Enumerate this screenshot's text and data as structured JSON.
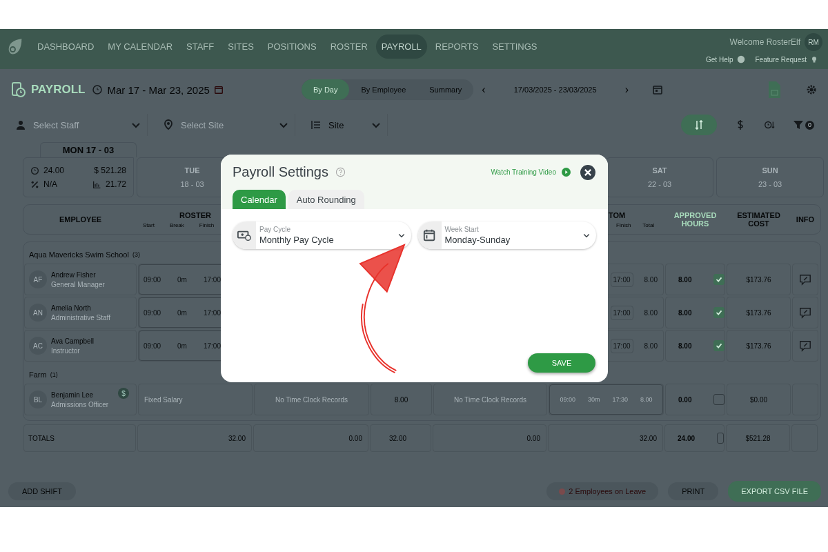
{
  "nav": {
    "items": [
      {
        "label": "DASHBOARD",
        "selected": false
      },
      {
        "label": "MY CALENDAR",
        "selected": false
      },
      {
        "label": "STAFF",
        "selected": false
      },
      {
        "label": "SITES",
        "selected": false
      },
      {
        "label": "POSITIONS",
        "selected": false
      },
      {
        "label": "ROSTER",
        "selected": false
      },
      {
        "label": "PAYROLL",
        "selected": true
      },
      {
        "label": "REPORTS",
        "selected": false
      },
      {
        "label": "SETTINGS",
        "selected": false
      }
    ],
    "welcome": "Welcome RosterElf",
    "avatar": "RM",
    "help": "Get Help",
    "feature": "Feature Request"
  },
  "header": {
    "title": "PAYROLL",
    "range": "Mar 17 - Mar 23, 2025",
    "views": [
      {
        "label": "By Day",
        "selected": true
      },
      {
        "label": "By Employee",
        "selected": false
      },
      {
        "label": "Summary",
        "selected": false
      }
    ],
    "prev": "‹",
    "date_range": "17/03/2025 - 23/03/2025",
    "next": "›"
  },
  "filters": {
    "staff": {
      "placeholder": "Select Staff"
    },
    "site": {
      "placeholder": "Select Site"
    },
    "group_by": {
      "value": "Site"
    },
    "filter_count": "0"
  },
  "days": [
    {
      "day": "MON",
      "date": "17 - 03",
      "selected": true,
      "hours": "24.00",
      "cost": "$ 521.28",
      "percent": "N/A",
      "average": "21.72"
    },
    {
      "day": "TUE",
      "date": "18 - 03",
      "selected": false
    },
    {
      "day": "SAT",
      "date": "22 - 03",
      "selected": false
    },
    {
      "day": "SUN",
      "date": "23 - 03",
      "selected": false
    }
  ],
  "table": {
    "columns": [
      {
        "title": "EMPLOYEE"
      },
      {
        "title": "ROSTER",
        "sub": [
          "Start",
          "Break",
          "Finish"
        ]
      },
      {
        "title": "TOM",
        "sub": [
          "Finish",
          "Total"
        ]
      },
      {
        "title": "APPROVED HOURS",
        "kind": "accent"
      },
      {
        "title": "ESTIMATED COST"
      },
      {
        "title": "INFO"
      }
    ],
    "groups": [
      {
        "name": "Aqua Mavericks Swim School",
        "count": "(3)",
        "rows": [
          {
            "kind": "shift",
            "initials": "AF",
            "name": "Andrew Fisher",
            "role": "General Manager",
            "roster": [
              "09:00",
              "0m",
              "17:00"
            ],
            "custom_finish": "17:00",
            "custom_total": "8.00",
            "approved": "8.00",
            "checked": true,
            "cost": "$173.76",
            "note": true
          },
          {
            "kind": "shift",
            "initials": "AN",
            "name": "Amelia North",
            "role": "Administrative Staff",
            "roster": [
              "09:00",
              "0m",
              "17:00"
            ],
            "custom_finish": "17:00",
            "custom_total": "8.00",
            "approved": "8.00",
            "checked": true,
            "cost": "$173.76",
            "note": true
          },
          {
            "kind": "shift",
            "initials": "AC",
            "name": "Ava Campbell",
            "role": "Instructor",
            "roster": [
              "09:00",
              "0m",
              "17:00"
            ],
            "custom_finish": "17:00",
            "custom_total": "8.00",
            "approved": "8.00",
            "checked": true,
            "cost": "$173.76",
            "note": true
          }
        ]
      },
      {
        "name": "Farm",
        "count": "(1)",
        "rows": [
          {
            "kind": "salary",
            "initials": "BL",
            "name": "Benjamin Lee",
            "role": "Admissions Officer",
            "badge": "$",
            "salary": "Fixed Salary",
            "clock": "No Time Clock Records",
            "hours": "8.00",
            "clock_2": "No Time Clock Records",
            "custom": [
              "09:00",
              "30m",
              "17:30",
              "8.00"
            ],
            "approved": "0.00",
            "checked": false,
            "cost": "$0.00",
            "note": false
          }
        ]
      }
    ],
    "totals": {
      "label": "TOTALS",
      "values": [
        "32.00",
        "0.00",
        "32.00",
        "0.00",
        "32.00"
      ],
      "approved": "24.00",
      "checked": false,
      "cost": "$521.28"
    }
  },
  "footer": {
    "add_shift": "ADD SHIFT",
    "leave": "2 Employees on Leave",
    "print": "PRINT",
    "export": "EXPORT CSV FILE"
  },
  "modal": {
    "title": "Payroll Settings",
    "video_link": "Watch Training Video",
    "tabs": [
      {
        "label": "Calendar",
        "selected": true
      },
      {
        "label": "Auto Rounding",
        "selected": false
      }
    ],
    "fields": [
      {
        "kind": "money",
        "label": "Pay Cycle",
        "value": "Monthly Pay Cycle"
      },
      {
        "kind": "calendar",
        "label": "Week Start",
        "value": "Monday-Sunday"
      }
    ],
    "save": "SAVE"
  }
}
